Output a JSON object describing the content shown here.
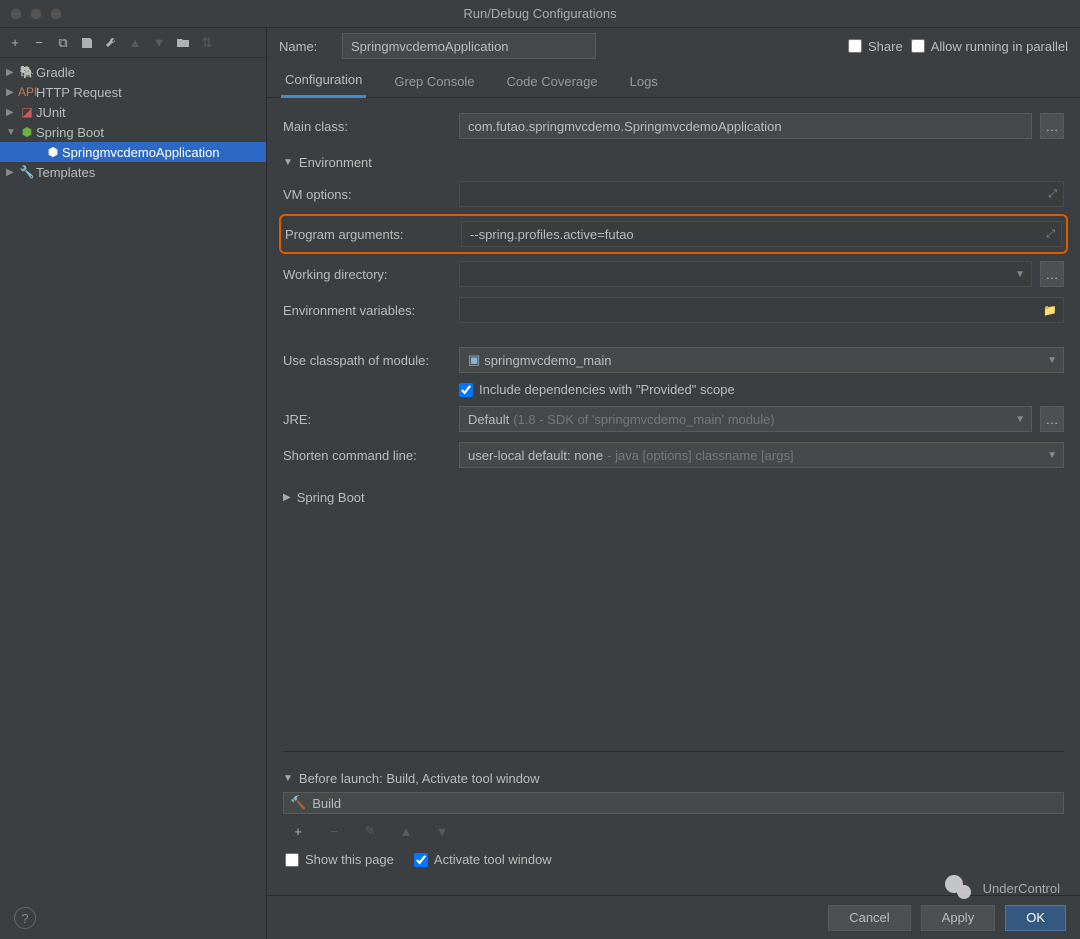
{
  "window": {
    "title": "Run/Debug Configurations"
  },
  "toolbar_icons": {
    "add": "+",
    "remove": "−",
    "copy": "⧉",
    "save": "💾",
    "wrench": "🔧",
    "up": "▲",
    "down": "▼",
    "folder": "📁",
    "sort": "↕"
  },
  "tree": {
    "items": [
      {
        "label": "Gradle",
        "icon": "gradle",
        "expanded": false
      },
      {
        "label": "HTTP Request",
        "icon": "http",
        "expanded": false
      },
      {
        "label": "JUnit",
        "icon": "junit",
        "expanded": false
      },
      {
        "label": "Spring Boot",
        "icon": "spring",
        "expanded": true,
        "children": [
          {
            "label": "SpringmvcdemoApplication",
            "selected": true
          }
        ]
      },
      {
        "label": "Templates",
        "icon": "templates",
        "expanded": false
      }
    ]
  },
  "name_row": {
    "label": "Name:",
    "value": "SpringmvcdemoApplication",
    "share": "Share",
    "allow_parallel": "Allow running in parallel"
  },
  "tabs": [
    {
      "label": "Configuration",
      "active": true
    },
    {
      "label": "Grep Console"
    },
    {
      "label": "Code Coverage"
    },
    {
      "label": "Logs"
    }
  ],
  "form": {
    "main_class": {
      "label": "Main class:",
      "value": "com.futao.springmvcdemo.SpringmvcdemoApplication"
    },
    "environment": {
      "label": "Environment"
    },
    "vm_options": {
      "label": "VM options:",
      "value": ""
    },
    "program_args": {
      "label": "Program arguments:",
      "value": "--spring.profiles.active=futao"
    },
    "working_dir": {
      "label": "Working directory:",
      "value": ""
    },
    "env_vars": {
      "label": "Environment variables:",
      "value": ""
    },
    "classpath": {
      "label": "Use classpath of module:",
      "value": "springmvcdemo_main"
    },
    "include_provided": {
      "label": "Include dependencies with \"Provided\" scope",
      "checked": true
    },
    "jre": {
      "label": "JRE:",
      "value": "Default",
      "hint": "(1.8 - SDK of 'springmvcdemo_main' module)"
    },
    "shorten": {
      "label": "Shorten command line:",
      "value": "user-local default: none",
      "hint": "- java [options] classname [args]"
    },
    "spring_boot": {
      "label": "Spring Boot"
    }
  },
  "before_launch": {
    "header": "Before launch: Build, Activate tool window",
    "build_label": "Build",
    "show_page": "Show this page",
    "activate": "Activate tool window"
  },
  "footer": {
    "cancel": "Cancel",
    "apply": "Apply",
    "ok": "OK"
  },
  "watermark": "UnderControl",
  "help_glyph": "?"
}
